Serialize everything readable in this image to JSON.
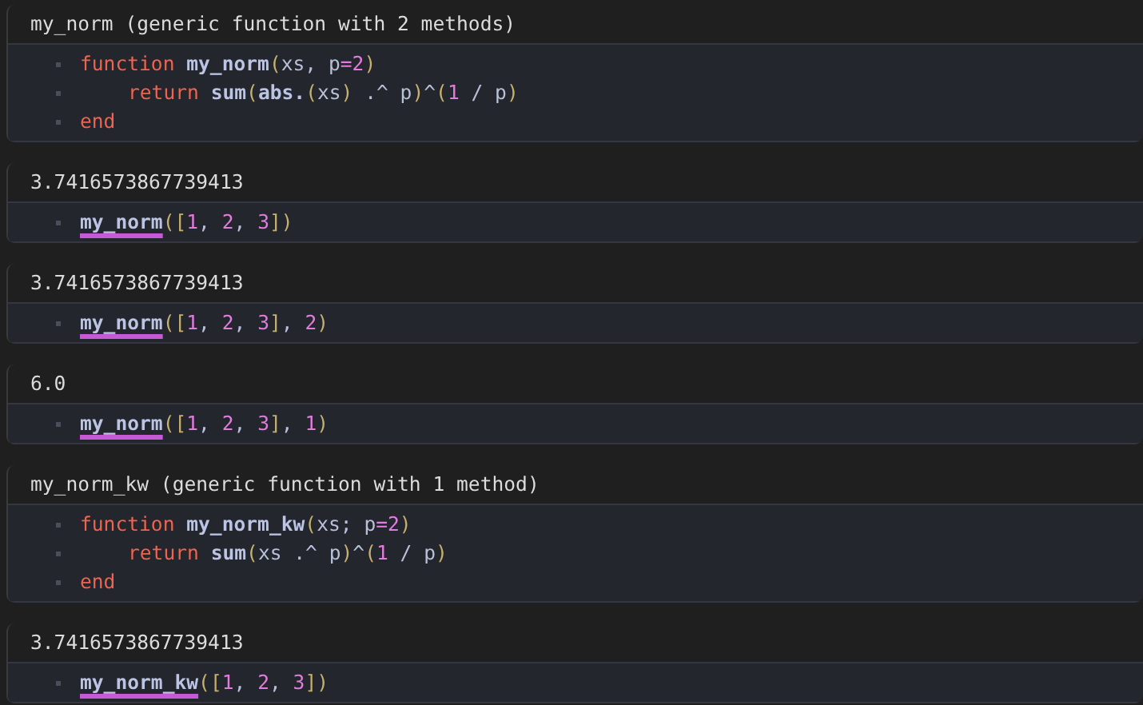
{
  "cells": [
    {
      "output": "my_norm (generic function with 2 methods)",
      "code": [
        {
          "indented": false,
          "tokens": [
            {
              "kind": "keyword",
              "text": "function"
            },
            {
              "kind": "name",
              "text": "my_norm"
            },
            {
              "kind": "paren",
              "text": "("
            },
            {
              "kind": "text",
              "text": "xs, p"
            },
            {
              "kind": "op",
              "text": "="
            },
            {
              "kind": "number",
              "text": "2"
            },
            {
              "kind": "paren",
              "text": ")"
            }
          ]
        },
        {
          "indented": true,
          "tokens": [
            {
              "kind": "keyword",
              "text": "return"
            },
            {
              "kind": "name",
              "text": "sum"
            },
            {
              "kind": "paren",
              "text": "("
            },
            {
              "kind": "name",
              "text": "abs."
            },
            {
              "kind": "paren",
              "text": "("
            },
            {
              "kind": "text",
              "text": "xs"
            },
            {
              "kind": "paren",
              "text": ")"
            },
            {
              "kind": "text",
              "text": " .^ p"
            },
            {
              "kind": "paren",
              "text": ")"
            },
            {
              "kind": "text",
              "text": "^"
            },
            {
              "kind": "paren",
              "text": "("
            },
            {
              "kind": "number",
              "text": "1"
            },
            {
              "kind": "text",
              "text": " / p"
            },
            {
              "kind": "paren",
              "text": ")"
            }
          ]
        },
        {
          "indented": false,
          "tokens": [
            {
              "kind": "keyword",
              "text": "end"
            }
          ]
        }
      ]
    },
    {
      "output": "3.7416573867739413",
      "code": [
        {
          "indented": false,
          "tokens": [
            {
              "kind": "link",
              "text": "my_norm"
            },
            {
              "kind": "paren",
              "text": "(["
            },
            {
              "kind": "number",
              "text": "1"
            },
            {
              "kind": "text",
              "text": ", "
            },
            {
              "kind": "number",
              "text": "2"
            },
            {
              "kind": "text",
              "text": ", "
            },
            {
              "kind": "number",
              "text": "3"
            },
            {
              "kind": "paren",
              "text": "])"
            }
          ]
        }
      ]
    },
    {
      "output": "3.7416573867739413",
      "code": [
        {
          "indented": false,
          "tokens": [
            {
              "kind": "link",
              "text": "my_norm"
            },
            {
              "kind": "paren",
              "text": "(["
            },
            {
              "kind": "number",
              "text": "1"
            },
            {
              "kind": "text",
              "text": ", "
            },
            {
              "kind": "number",
              "text": "2"
            },
            {
              "kind": "text",
              "text": ", "
            },
            {
              "kind": "number",
              "text": "3"
            },
            {
              "kind": "paren",
              "text": "]"
            },
            {
              "kind": "text",
              "text": ", "
            },
            {
              "kind": "number",
              "text": "2"
            },
            {
              "kind": "paren",
              "text": ")"
            }
          ]
        }
      ]
    },
    {
      "output": "6.0",
      "code": [
        {
          "indented": false,
          "tokens": [
            {
              "kind": "link",
              "text": "my_norm"
            },
            {
              "kind": "paren",
              "text": "(["
            },
            {
              "kind": "number",
              "text": "1"
            },
            {
              "kind": "text",
              "text": ", "
            },
            {
              "kind": "number",
              "text": "2"
            },
            {
              "kind": "text",
              "text": ", "
            },
            {
              "kind": "number",
              "text": "3"
            },
            {
              "kind": "paren",
              "text": "]"
            },
            {
              "kind": "text",
              "text": ", "
            },
            {
              "kind": "number",
              "text": "1"
            },
            {
              "kind": "paren",
              "text": ")"
            }
          ]
        }
      ]
    },
    {
      "output": "my_norm_kw (generic function with 1 method)",
      "code": [
        {
          "indented": false,
          "tokens": [
            {
              "kind": "keyword",
              "text": "function"
            },
            {
              "kind": "name",
              "text": "my_norm_kw"
            },
            {
              "kind": "paren",
              "text": "("
            },
            {
              "kind": "text",
              "text": "xs; p"
            },
            {
              "kind": "op",
              "text": "="
            },
            {
              "kind": "number",
              "text": "2"
            },
            {
              "kind": "paren",
              "text": ")"
            }
          ]
        },
        {
          "indented": true,
          "tokens": [
            {
              "kind": "keyword",
              "text": "return"
            },
            {
              "kind": "name",
              "text": "sum"
            },
            {
              "kind": "paren",
              "text": "("
            },
            {
              "kind": "text",
              "text": "xs .^ p"
            },
            {
              "kind": "paren",
              "text": ")"
            },
            {
              "kind": "text",
              "text": "^"
            },
            {
              "kind": "paren",
              "text": "("
            },
            {
              "kind": "number",
              "text": "1"
            },
            {
              "kind": "text",
              "text": " / p"
            },
            {
              "kind": "paren",
              "text": ")"
            }
          ]
        },
        {
          "indented": false,
          "tokens": [
            {
              "kind": "keyword",
              "text": "end"
            }
          ]
        }
      ]
    },
    {
      "output": "3.7416573867739413",
      "code": [
        {
          "indented": false,
          "tokens": [
            {
              "kind": "link",
              "text": "my_norm_kw"
            },
            {
              "kind": "paren",
              "text": "(["
            },
            {
              "kind": "number",
              "text": "1"
            },
            {
              "kind": "text",
              "text": ", "
            },
            {
              "kind": "number",
              "text": "2"
            },
            {
              "kind": "text",
              "text": ", "
            },
            {
              "kind": "number",
              "text": "3"
            },
            {
              "kind": "paren",
              "text": "])"
            }
          ]
        }
      ]
    }
  ]
}
